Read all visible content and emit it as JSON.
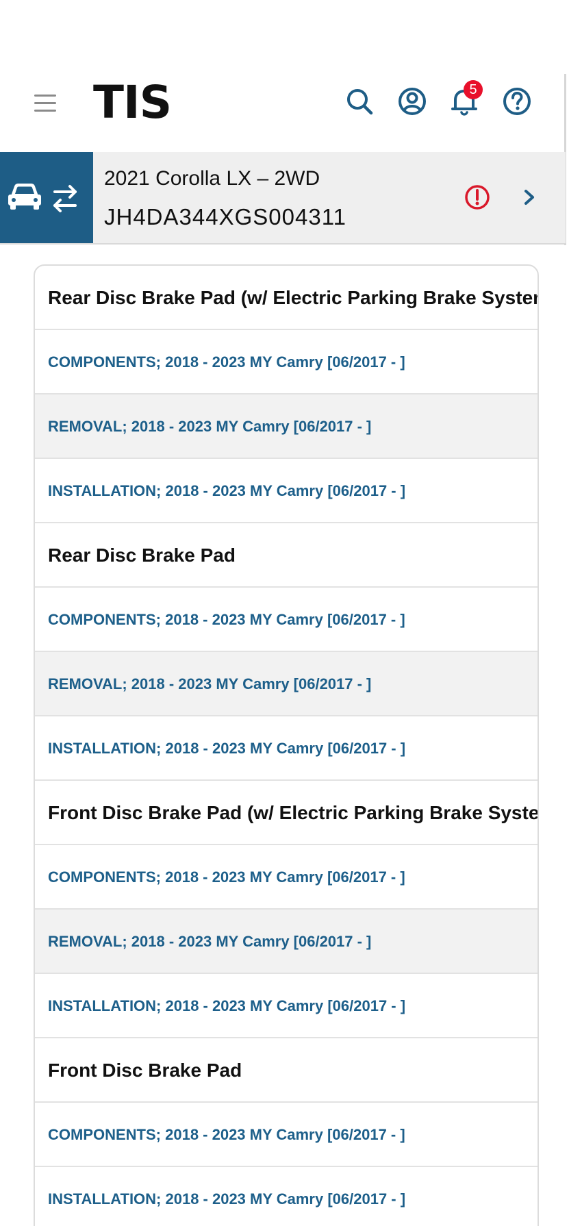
{
  "header": {
    "logo_text": "TIS",
    "notification_count": "5"
  },
  "vehicle": {
    "name": "2021 Corolla LX – 2WD",
    "vin": "JH4DA344XGS004311"
  },
  "colors": {
    "brand_blue": "#1e5d86",
    "link_blue": "#1d5f8a",
    "badge_red": "#e8102b",
    "alert_red": "#d9182a"
  },
  "sections": [
    {
      "title": "Rear Disc Brake Pad (w/ Electric Parking Brake System)",
      "links": [
        "COMPONENTS; 2018 - 2023 MY Camry [06/2017 -   ]",
        "REMOVAL; 2018 - 2023 MY Camry [06/2017  -  ]",
        "INSTALLATION; 2018 - 2023 MY Camry [06/2017 -  ]"
      ]
    },
    {
      "title": "Rear Disc Brake Pad",
      "links": [
        "COMPONENTS; 2018 - 2023 MY Camry [06/2017 -   ]",
        "REMOVAL; 2018 - 2023 MY Camry [06/2017  -  ]",
        "INSTALLATION; 2018 - 2023 MY Camry [06/2017 -  ]"
      ]
    },
    {
      "title": "Front Disc Brake Pad (w/ Electric Parking Brake System)",
      "links": [
        "COMPONENTS; 2018 - 2023 MY Camry [06/2017 -   ]",
        "REMOVAL; 2018 - 2023 MY Camry [06/2017  -  ]",
        "INSTALLATION; 2018 - 2023 MY Camry [06/2017 -  ]"
      ]
    },
    {
      "title": "Front Disc Brake Pad",
      "links": [
        "COMPONENTS; 2018 - 2023 MY Camry [06/2017 -   ]",
        "INSTALLATION; 2018 - 2023 MY Camry [06/2017 -  ]"
      ]
    }
  ]
}
